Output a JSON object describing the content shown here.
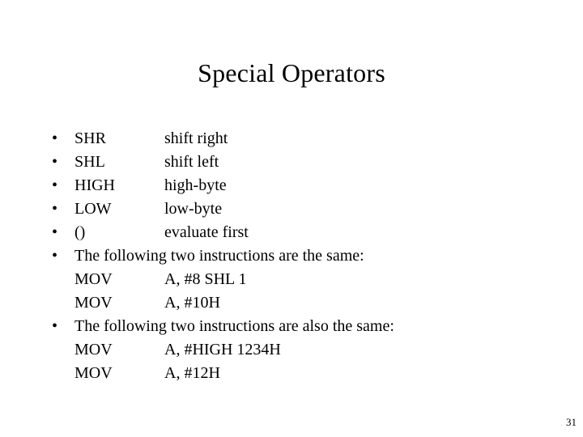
{
  "slide": {
    "title": "Special Operators",
    "page_number": "31",
    "bullet_glyph": "•",
    "operators": [
      {
        "name": "SHR",
        "meaning": "shift right"
      },
      {
        "name": "SHL",
        "meaning": "shift left"
      },
      {
        "name": "HIGH",
        "meaning": "high-byte"
      },
      {
        "name": "LOW",
        "meaning": "low-byte"
      },
      {
        "name": "()",
        "meaning": "evaluate first"
      }
    ],
    "examples": [
      {
        "heading": "The following two instructions are the same:",
        "instructions": [
          {
            "mnemonic": "MOV",
            "operands": "A, #8 SHL 1"
          },
          {
            "mnemonic": "MOV",
            "operands": "A, #10H"
          }
        ]
      },
      {
        "heading": "The following two instructions are also the same:",
        "instructions": [
          {
            "mnemonic": "MOV",
            "operands": "A, #HIGH 1234H"
          },
          {
            "mnemonic": "MOV",
            "operands": "A, #12H"
          }
        ]
      }
    ]
  }
}
